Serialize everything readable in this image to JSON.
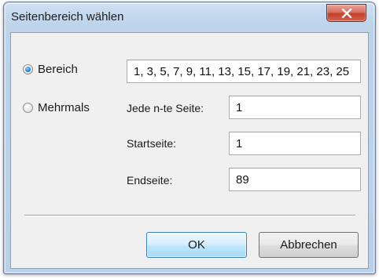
{
  "window": {
    "title": "Seitenbereich wählen"
  },
  "options": {
    "bereich_label": "Bereich",
    "mehrmals_label": "Mehrmals",
    "selected": "Bereich"
  },
  "fields": {
    "bereich_value": "1, 3, 5, 7, 9, 11, 13, 15, 17, 19, 21, 23, 25",
    "jede_label": "Jede n-te Seite:",
    "jede_value": "1",
    "start_label": "Startseite:",
    "start_value": "1",
    "end_label": "Endseite:",
    "end_value": "89"
  },
  "buttons": {
    "ok_label": "OK",
    "cancel_label": "Abbrechen"
  },
  "icons": {
    "close": "close-icon"
  },
  "colors": {
    "close_button": "#c94a36",
    "default_button_border": "#3c7fb1",
    "title_bar": "#bcd3ea"
  }
}
